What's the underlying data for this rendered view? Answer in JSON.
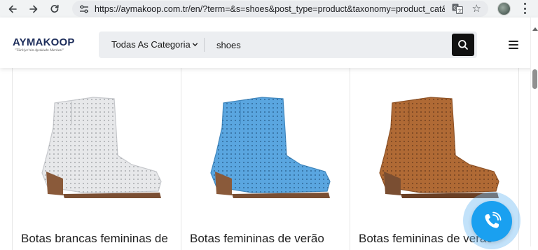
{
  "browser": {
    "url": "https://aymakoop.com.tr/en/?term=&s=shoes&post_type=product&taxonomy=product_cat&tr...",
    "icons": [
      "back-icon",
      "forward-icon",
      "reload-icon",
      "site-settings-icon",
      "translate-icon",
      "star-icon",
      "profile-avatar",
      "more-menu-icon"
    ]
  },
  "header": {
    "brand": "AYMAKOOP",
    "tagline": "\"Türkiye'nin Ayakkabı Merkezi\"",
    "category_select": "Todas As Categoria",
    "search_value": "shoes",
    "icons": [
      "chevron-down-icon",
      "search-icon",
      "hamburger-menu-icon"
    ]
  },
  "products": [
    {
      "title": "Botas brancas femininas de",
      "color": "#e7e8ea"
    },
    {
      "title": "Botas femininas de verão",
      "color": "#5aa6e0"
    },
    {
      "title": "Botas femininas de verão",
      "color": "#b06a35"
    }
  ],
  "floating": {
    "icon": "phone-call-icon",
    "color": "#1aa0f0"
  }
}
